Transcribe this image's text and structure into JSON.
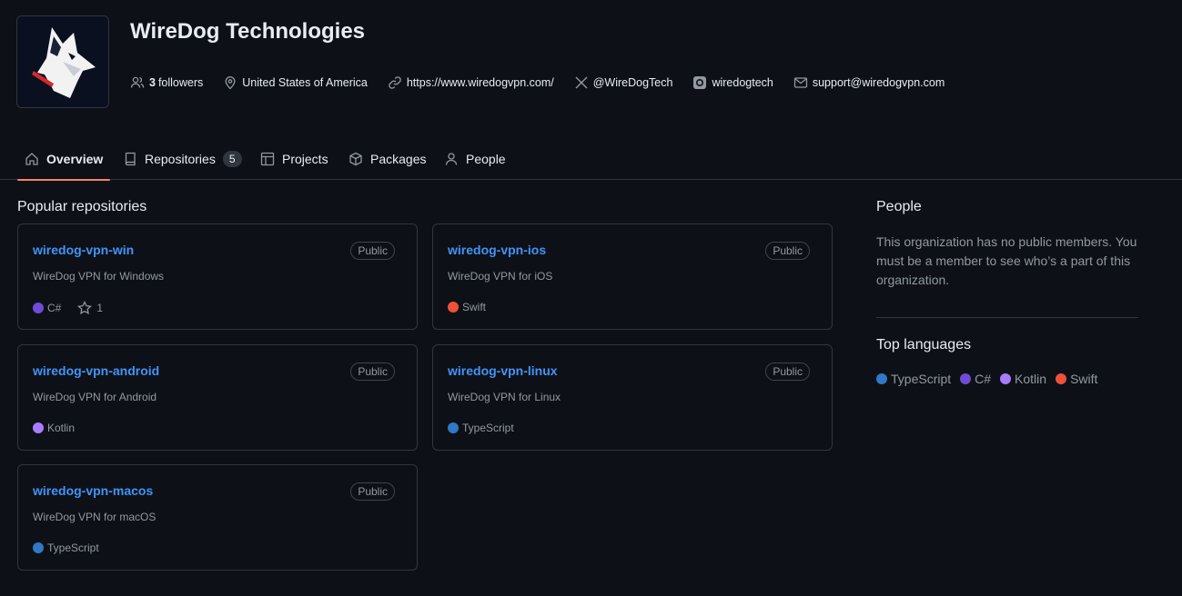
{
  "org": {
    "name": "WireDog Technologies"
  },
  "meta": {
    "followers_count": "3",
    "followers_label": "followers",
    "location": "United States of America",
    "website": "https://www.wiredogvpn.com/",
    "twitter": "@WireDogTech",
    "instagram": "wiredogtech",
    "email": "support@wiredogvpn.com"
  },
  "tabs": [
    {
      "label": "Overview",
      "icon": "home-icon"
    },
    {
      "label": "Repositories",
      "icon": "repo-icon",
      "count": "5"
    },
    {
      "label": "Projects",
      "icon": "table-icon"
    },
    {
      "label": "Packages",
      "icon": "package-icon"
    },
    {
      "label": "People",
      "icon": "person-icon"
    }
  ],
  "popular": {
    "title": "Popular repositories",
    "repos": [
      {
        "name": "wiredog-vpn-win",
        "visibility": "Public",
        "description": "WireDog VPN for Windows",
        "language": "C#",
        "lang_color": "#6e4cd8",
        "stars": "1"
      },
      {
        "name": "wiredog-vpn-ios",
        "visibility": "Public",
        "description": "WireDog VPN for iOS",
        "language": "Swift",
        "lang_color": "#f05138"
      },
      {
        "name": "wiredog-vpn-android",
        "visibility": "Public",
        "description": "WireDog VPN for Android",
        "language": "Kotlin",
        "lang_color": "#a97bff"
      },
      {
        "name": "wiredog-vpn-linux",
        "visibility": "Public",
        "description": "WireDog VPN for Linux",
        "language": "TypeScript",
        "lang_color": "#3178c6"
      },
      {
        "name": "wiredog-vpn-macos",
        "visibility": "Public",
        "description": "WireDog VPN for macOS",
        "language": "TypeScript",
        "lang_color": "#3178c6"
      }
    ]
  },
  "people": {
    "title": "People",
    "text": "This organization has no public members. You must be a member to see who’s a part of this organization."
  },
  "top_languages": {
    "title": "Top languages",
    "items": [
      {
        "name": "TypeScript",
        "color": "#3178c6"
      },
      {
        "name": "C#",
        "color": "#6e4cd8"
      },
      {
        "name": "Kotlin",
        "color": "#a97bff"
      },
      {
        "name": "Swift",
        "color": "#f05138"
      }
    ]
  },
  "colors": {
    "background": "#0d1117",
    "link": "#4493f8",
    "tab_underline": "#f78166",
    "border": "#30363d"
  }
}
